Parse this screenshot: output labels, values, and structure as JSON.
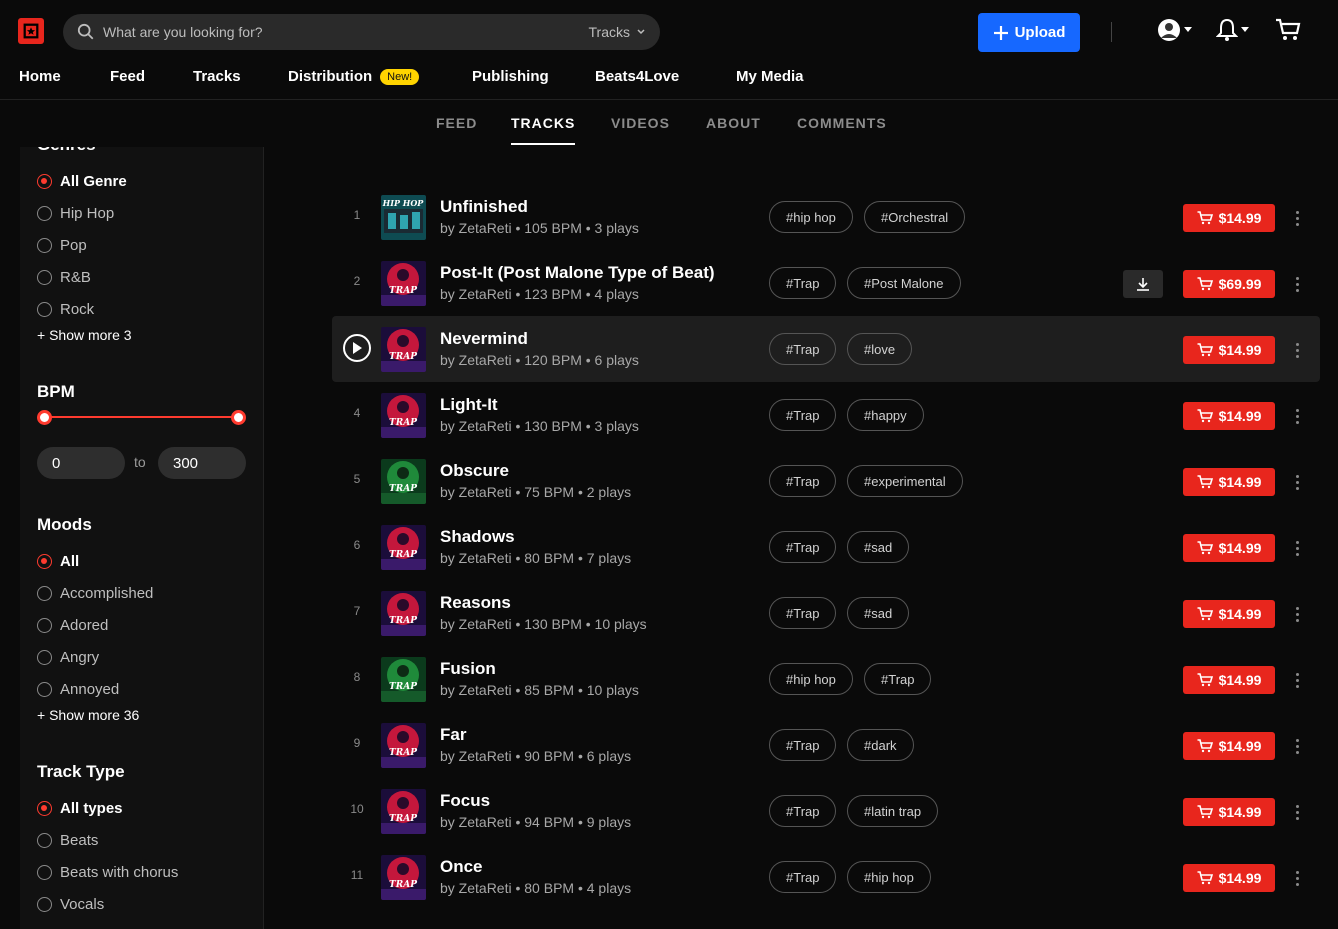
{
  "header": {
    "search_placeholder": "What are you looking for?",
    "search_scope": "Tracks",
    "upload_label": "Upload"
  },
  "nav": {
    "home": "Home",
    "feed": "Feed",
    "tracks": "Tracks",
    "distribution": "Distribution",
    "new_badge": "New!",
    "publishing": "Publishing",
    "beats4love": "Beats4Love",
    "my_media": "My Media"
  },
  "tabs": [
    "FEED",
    "TRACKS",
    "VIDEOS",
    "ABOUT",
    "COMMENTS"
  ],
  "sidebar": {
    "genre_heading": "Genres",
    "genres": [
      "All Genre",
      "Hip Hop",
      "Pop",
      "R&B",
      "Rock"
    ],
    "genre_show_more": "+ Show more 3",
    "bpm_heading": "BPM",
    "bpm_min": "0",
    "bpm_to": "to",
    "bpm_max": "300",
    "moods_heading": "Moods",
    "moods": [
      "All",
      "Accomplished",
      "Adored",
      "Angry",
      "Annoyed"
    ],
    "moods_show_more": "+ Show more 36",
    "track_type_heading": "Track Type",
    "track_types": [
      "All types",
      "Beats",
      "Beats with chorus",
      "Vocals"
    ]
  },
  "tracks": [
    {
      "num": "1",
      "title": "Unfinished",
      "meta": "by ZetaReti • 105 BPM • 3 plays",
      "tags": [
        "#hip hop",
        "#Orchestral"
      ],
      "price": "$14.99",
      "cover": "hiphop"
    },
    {
      "num": "2",
      "title": "Post-It (Post Malone Type of Beat)",
      "meta": "by ZetaReti • 123 BPM • 4 plays",
      "tags": [
        "#Trap",
        "#Post Malone"
      ],
      "price": "$69.99",
      "cover": "trap",
      "download": true
    },
    {
      "num": "3",
      "title": "Nevermind",
      "meta": "by ZetaReti • 120 BPM • 6 plays",
      "tags": [
        "#Trap",
        "#love"
      ],
      "price": "$14.99",
      "cover": "trap",
      "hover": true
    },
    {
      "num": "4",
      "title": "Light-It",
      "meta": "by ZetaReti • 130 BPM • 3 plays",
      "tags": [
        "#Trap",
        "#happy"
      ],
      "price": "$14.99",
      "cover": "trap"
    },
    {
      "num": "5",
      "title": "Obscure",
      "meta": "by ZetaReti • 75 BPM • 2 plays",
      "tags": [
        "#Trap",
        "#experimental"
      ],
      "price": "$14.99",
      "cover": "green"
    },
    {
      "num": "6",
      "title": "Shadows",
      "meta": "by ZetaReti • 80 BPM • 7 plays",
      "tags": [
        "#Trap",
        "#sad"
      ],
      "price": "$14.99",
      "cover": "trap"
    },
    {
      "num": "7",
      "title": "Reasons",
      "meta": "by ZetaReti • 130 BPM • 10 plays",
      "tags": [
        "#Trap",
        "#sad"
      ],
      "price": "$14.99",
      "cover": "trap"
    },
    {
      "num": "8",
      "title": "Fusion",
      "meta": "by ZetaReti • 85 BPM • 10 plays",
      "tags": [
        "#hip hop",
        "#Trap"
      ],
      "price": "$14.99",
      "cover": "green"
    },
    {
      "num": "9",
      "title": "Far",
      "meta": "by ZetaReti • 90 BPM • 6 plays",
      "tags": [
        "#Trap",
        "#dark"
      ],
      "price": "$14.99",
      "cover": "trap"
    },
    {
      "num": "10",
      "title": "Focus",
      "meta": "by ZetaReti • 94 BPM • 9 plays",
      "tags": [
        "#Trap",
        "#latin trap"
      ],
      "price": "$14.99",
      "cover": "trap"
    },
    {
      "num": "11",
      "title": "Once",
      "meta": "by ZetaReti • 80 BPM • 4 plays",
      "tags": [
        "#Trap",
        "#hip hop"
      ],
      "price": "$14.99",
      "cover": "trap"
    }
  ],
  "colors": {
    "accent": "#e8261d",
    "upload": "#1668ff",
    "badge": "#ffd400"
  }
}
